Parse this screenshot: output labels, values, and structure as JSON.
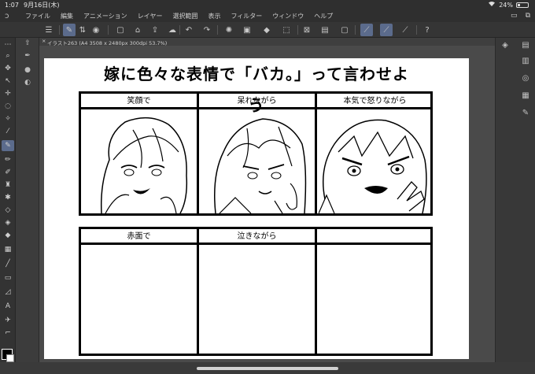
{
  "status": {
    "time": "1:07",
    "date": "9月16日(木)",
    "battery": "24%",
    "battery_level": 0.24
  },
  "menu": {
    "items": [
      "ファイル",
      "編集",
      "アニメーション",
      "レイヤー",
      "選択範囲",
      "表示",
      "フィルター",
      "ウィンドウ",
      "ヘルプ"
    ]
  },
  "tab": {
    "close": "×",
    "title": "イラスト263 (A4 3508 x 2480px 300dpi 53.7%)"
  },
  "canvas": {
    "headline": "嫁に色々な表情で「バカ。」って言わせよう",
    "row1": [
      "笑顔で",
      "呆れながら",
      "本気で怒りながら"
    ],
    "row2": [
      "赤面で",
      "泣きながら",
      ""
    ]
  },
  "colors": {
    "accent": "#5b6b8c",
    "background": "#3a3a3a",
    "paper": "#ffffff",
    "ink": "#000000"
  }
}
